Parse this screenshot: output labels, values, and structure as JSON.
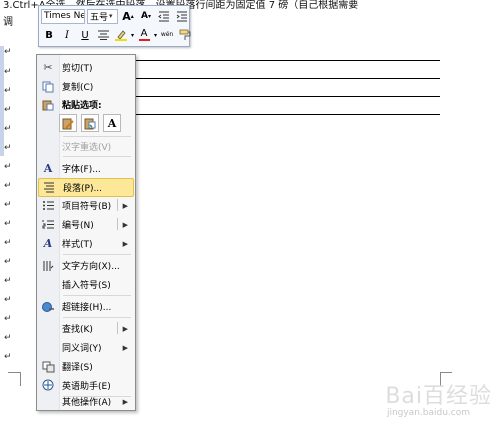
{
  "document": {
    "line1": "3.Ctrl+A全选，然后在选中段落，设置段落行间距为固定值 7 磅（自己根据需要",
    "line2": "调"
  },
  "mini_toolbar": {
    "font_name": "Times Ne",
    "font_size": "五号",
    "grow_font": "A",
    "shrink_font": "A",
    "bold": "B",
    "italic": "I",
    "underline": "U",
    "font_color": "A",
    "phonetic": "wén"
  },
  "context_menu": {
    "items": [
      {
        "label": "剪切(T)",
        "icon": "scissors-icon"
      },
      {
        "label": "复制(C)",
        "icon": "copy-icon"
      },
      {
        "label": "粘贴选项:",
        "icon": "paste-icon"
      },
      {
        "label": "汉字重选(V)",
        "icon": "none"
      },
      {
        "label": "字体(F)...",
        "icon": "font-icon"
      },
      {
        "label": "段落(P)...",
        "icon": "paragraph-icon"
      },
      {
        "label": "项目符号(B)",
        "icon": "bullets-icon"
      },
      {
        "label": "编号(N)",
        "icon": "numbering-icon"
      },
      {
        "label": "样式(T)",
        "icon": "styles-icon"
      },
      {
        "label": "文字方向(X)...",
        "icon": "text-direction-icon"
      },
      {
        "label": "插入符号(S)",
        "icon": "none"
      },
      {
        "label": "超链接(H)...",
        "icon": "hyperlink-icon"
      },
      {
        "label": "查找(K)",
        "icon": "none"
      },
      {
        "label": "同义词(Y)",
        "icon": "none"
      },
      {
        "label": "翻译(S)",
        "icon": "translate-icon"
      },
      {
        "label": "英语助手(E)",
        "icon": "english-assistant-icon"
      },
      {
        "label": "其他操作(A)",
        "icon": "none"
      }
    ],
    "paste_a": "A"
  },
  "watermark": {
    "text": "Bai百经验",
    "url": "jingyan.baidu.com"
  }
}
